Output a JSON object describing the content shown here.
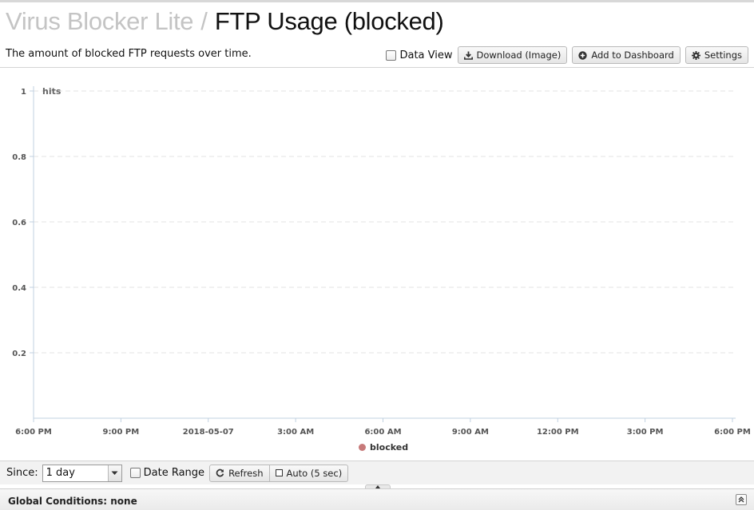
{
  "header": {
    "app_name": "Virus Blocker Lite",
    "separator": "/",
    "report_title": "FTP Usage (blocked)"
  },
  "toolbar": {
    "description": "The amount of blocked FTP requests over time.",
    "data_view_label": "Data View",
    "data_view_checked": false,
    "download_label": "Download (Image)",
    "add_dashboard_label": "Add to Dashboard",
    "settings_label": "Settings",
    "icons": [
      "download-icon",
      "plus-circle-icon",
      "gear-icon"
    ]
  },
  "chart_data": {
    "type": "line",
    "title": "",
    "unit_label": "hits",
    "ylabel": "",
    "xlabel": "",
    "ylim": [
      0,
      1
    ],
    "y_ticks": [
      "1",
      "0.8",
      "0.6",
      "0.4",
      "0.2"
    ],
    "x_ticks": [
      "6:00 PM",
      "9:00 PM",
      "2018-05-07",
      "3:00 AM",
      "6:00 AM",
      "9:00 AM",
      "12:00 PM",
      "3:00 PM",
      "6:00 PM"
    ],
    "grid": true,
    "legend_position": "bottom-center",
    "series": [
      {
        "name": "blocked",
        "color": "#c77a7a",
        "values": []
      }
    ]
  },
  "bottom": {
    "since_label": "Since:",
    "since_value": "1 day",
    "date_range_label": "Date Range",
    "date_range_checked": false,
    "refresh_label": "Refresh",
    "auto_label": "Auto (5 sec)"
  },
  "global_conditions": {
    "label": "Global Conditions: none"
  },
  "colors": {
    "title_muted": "#c4c4c4",
    "grid": "#e3e3e3",
    "axis": "#c0d0e0",
    "series_blocked": "#c77a7a"
  }
}
